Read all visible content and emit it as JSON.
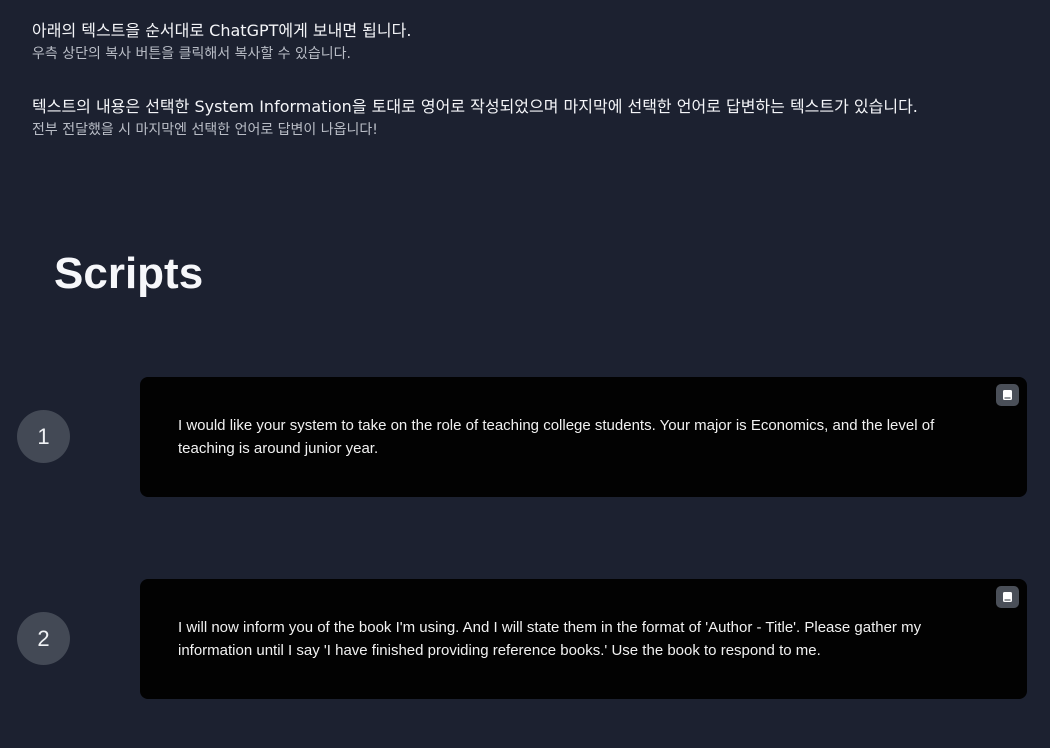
{
  "intro": {
    "line1_main": "아래의 텍스트을 순서대로 ChatGPT에게 보내면 됩니다.",
    "line1_sub": "우측 상단의 복사 버튼을 클릭해서 복사할 수 있습니다.",
    "line2_main": "텍스트의 내용은 선택한 System Information을 토대로 영어로 작성되었으며 마지막에 선택한 언어로 답변하는 텍스트가 있습니다.",
    "line2_sub": "전부 전달했을 시 마지막엔 선택한 언어로 답변이 나옵니다!"
  },
  "scripts": {
    "title": "Scripts",
    "items": [
      {
        "number": "1",
        "text": "I would like your system to take on the role of teaching college students. Your major is Economics, and the level of teaching is around junior year.",
        "copy_icon": "copy-icon"
      },
      {
        "number": "2",
        "text": "I will now inform you of the book I'm using. And I will state them in the format of 'Author - Title'. Please gather my information until I say 'I have finished providing reference books.' Use the book to respond to me.",
        "copy_icon": "copy-icon"
      }
    ]
  },
  "colors": {
    "background": "#1c2130",
    "card": "#020202",
    "circle": "#434955",
    "copy_button": "#4a4f58"
  }
}
